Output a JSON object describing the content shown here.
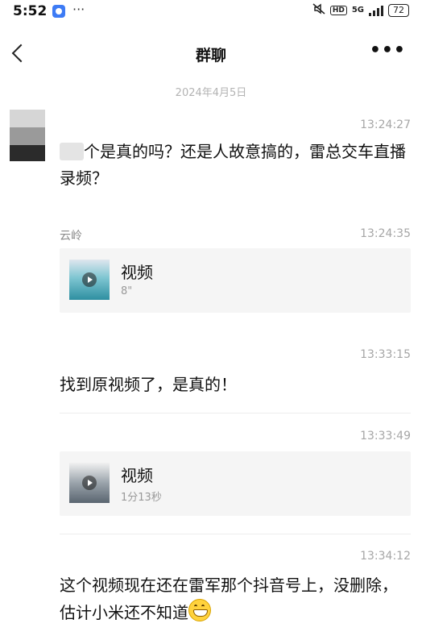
{
  "status": {
    "time": "5:52",
    "more": "···",
    "hd": "HD",
    "net": "5G",
    "battery": "72"
  },
  "header": {
    "title": "群聊",
    "more": "•••"
  },
  "date_separator": "2024年4月5日",
  "messages": [
    {
      "time": "13:24:27",
      "text_visible": "个是真的吗？还是人故意搞的，雷总交车直播录频？"
    },
    {
      "time": "13:24:35",
      "sender": "云岭",
      "video_label": "视频",
      "video_duration": "8\""
    },
    {
      "time": "13:33:15",
      "text": "找到原视频了，是真的！"
    },
    {
      "time": "13:33:49",
      "video_label": "视频",
      "video_duration": "1分13秒"
    },
    {
      "time": "13:34:12",
      "text": "这个视频现在还在雷军那个抖音号上，没删除，估计小米还不知道"
    }
  ]
}
